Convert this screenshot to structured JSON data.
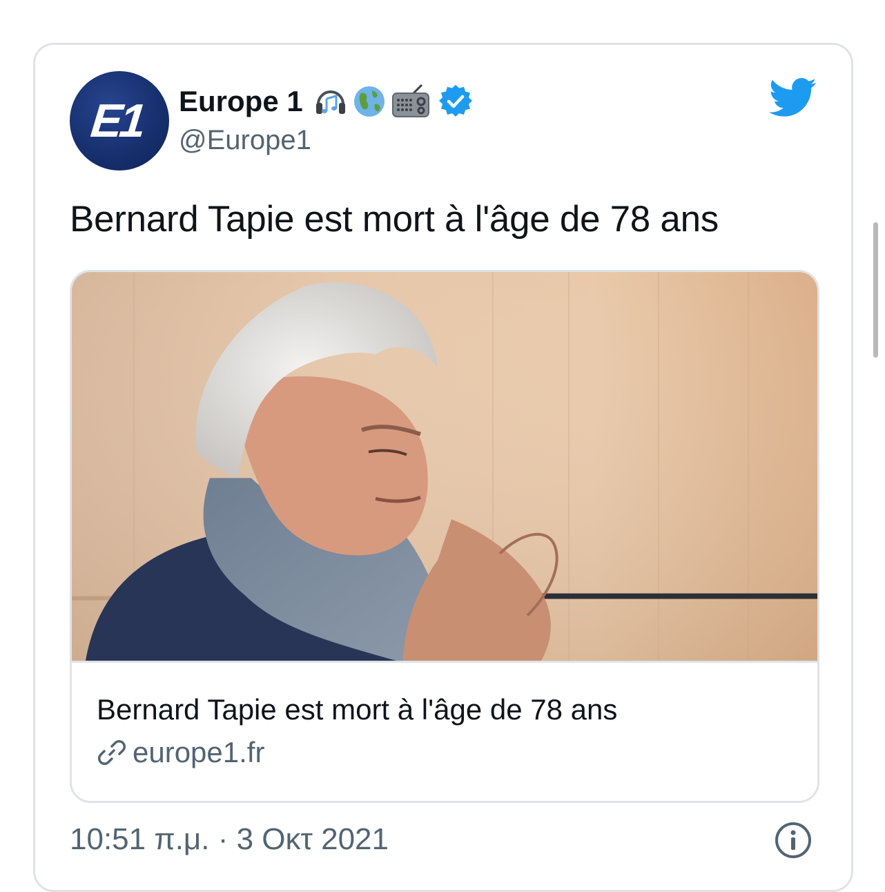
{
  "tweet": {
    "avatar_text": "E1",
    "display_name": "Europe 1",
    "name_emojis": [
      "headphone-emoji",
      "globe-emoji",
      "radio-emoji"
    ],
    "verified": true,
    "handle": "@Europe1",
    "text": "Bernard Tapie est mort à l'âge de 78 ans",
    "link_card": {
      "title": "Bernard Tapie est mort à l'âge de 78 ans",
      "domain": "europe1.fr",
      "image_icon": "photo-of-man-with-scarf"
    },
    "timestamp": "10:51 π.μ. · 3 Οκτ 2021"
  },
  "colors": {
    "twitter_blue": "#1d9bf0",
    "avatar_navy": "#17306f",
    "muted_text": "#536471",
    "border": "#dfe3e6"
  },
  "icons": {
    "brand": "twitter-bird-icon",
    "verified": "verified-badge-icon",
    "link": "link-icon",
    "info": "info-icon"
  }
}
